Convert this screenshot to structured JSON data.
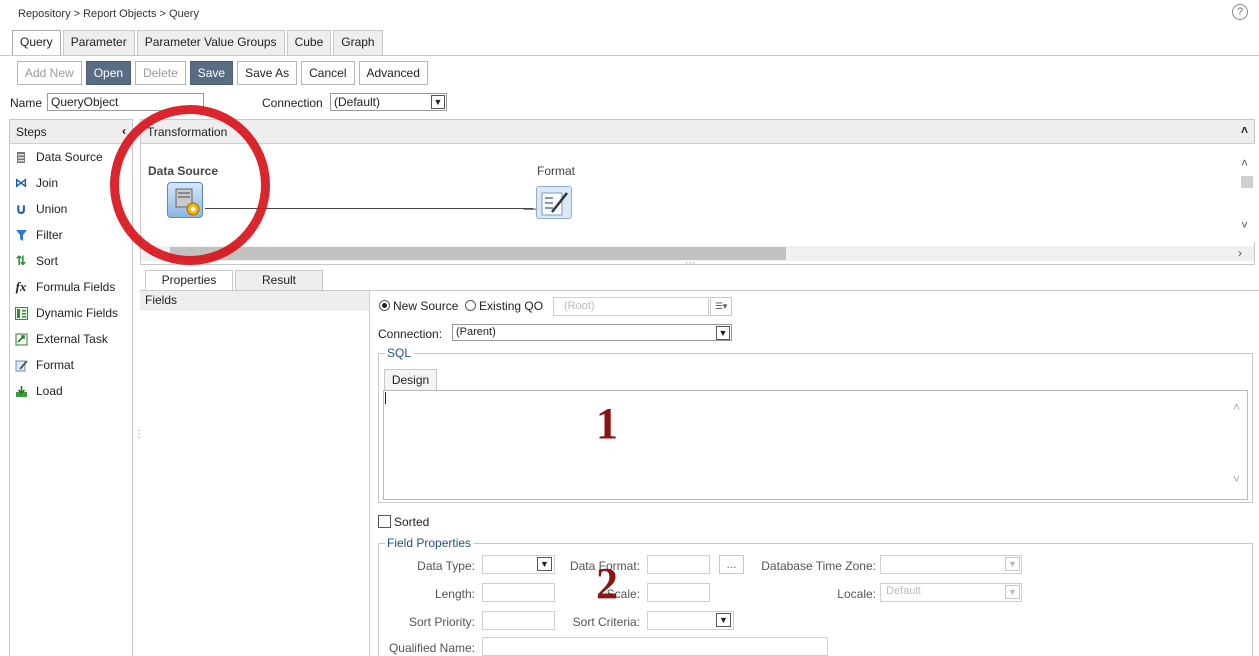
{
  "breadcrumb": "Repository > Report Objects > Query",
  "help_icon": "?",
  "tabs": [
    {
      "label": "Query",
      "active": true
    },
    {
      "label": "Parameter",
      "active": false
    },
    {
      "label": "Parameter Value Groups",
      "active": false
    },
    {
      "label": "Cube",
      "active": false
    },
    {
      "label": "Graph",
      "active": false
    }
  ],
  "toolbar": {
    "add_new": "Add New",
    "open": "Open",
    "delete": "Delete",
    "save": "Save",
    "save_as": "Save As",
    "cancel": "Cancel",
    "advanced": "Advanced"
  },
  "name": {
    "label": "Name",
    "value": "QueryObject"
  },
  "connection": {
    "label": "Connection",
    "value": "(Default)"
  },
  "steps": {
    "title": "Steps",
    "items": [
      {
        "label": "Data Source",
        "icon": "data-source-icon"
      },
      {
        "label": "Join",
        "icon": "join-icon"
      },
      {
        "label": "Union",
        "icon": "union-icon"
      },
      {
        "label": "Filter",
        "icon": "filter-icon"
      },
      {
        "label": "Sort",
        "icon": "sort-icon"
      },
      {
        "label": "Formula Fields",
        "icon": "formula-icon"
      },
      {
        "label": "Dynamic Fields",
        "icon": "dynamic-fields-icon"
      },
      {
        "label": "External Task",
        "icon": "external-task-icon"
      },
      {
        "label": "Format",
        "icon": "format-icon"
      },
      {
        "label": "Load",
        "icon": "load-icon"
      }
    ]
  },
  "transformation": {
    "title": "Transformation",
    "nodes": {
      "data_source": "Data Source",
      "format": "Format"
    }
  },
  "annotations": {
    "one": "1",
    "two": "2"
  },
  "property_tabs": [
    {
      "label": "Properties",
      "active": true
    },
    {
      "label": "Result",
      "active": false
    }
  ],
  "fields": {
    "title": "Fields"
  },
  "source": {
    "new_source": "New Source",
    "existing_qo": "Existing QO",
    "selected": "new_source",
    "root_placeholder": "(Root)",
    "connection_label": "Connection:",
    "connection_value": "(Parent)"
  },
  "sql": {
    "legend": "SQL",
    "design": "Design",
    "text": ""
  },
  "sorted": {
    "label": "Sorted",
    "checked": false
  },
  "field_properties": {
    "legend": "Field Properties",
    "data_type": "Data Type:",
    "data_format": "Data Format:",
    "dots": "...",
    "database_time_zone": "Database Time Zone:",
    "length": "Length:",
    "scale": "Scale:",
    "locale": "Locale:",
    "locale_value": "Default",
    "sort_priority": "Sort Priority:",
    "sort_criteria": "Sort Criteria:",
    "qualified_name": "Qualified Name:"
  },
  "colors": {
    "primary_button": "#5a6b84",
    "legend_text": "#1f4f91",
    "annotation_circle": "#d7141a",
    "annotation_number": "#8b1414"
  }
}
